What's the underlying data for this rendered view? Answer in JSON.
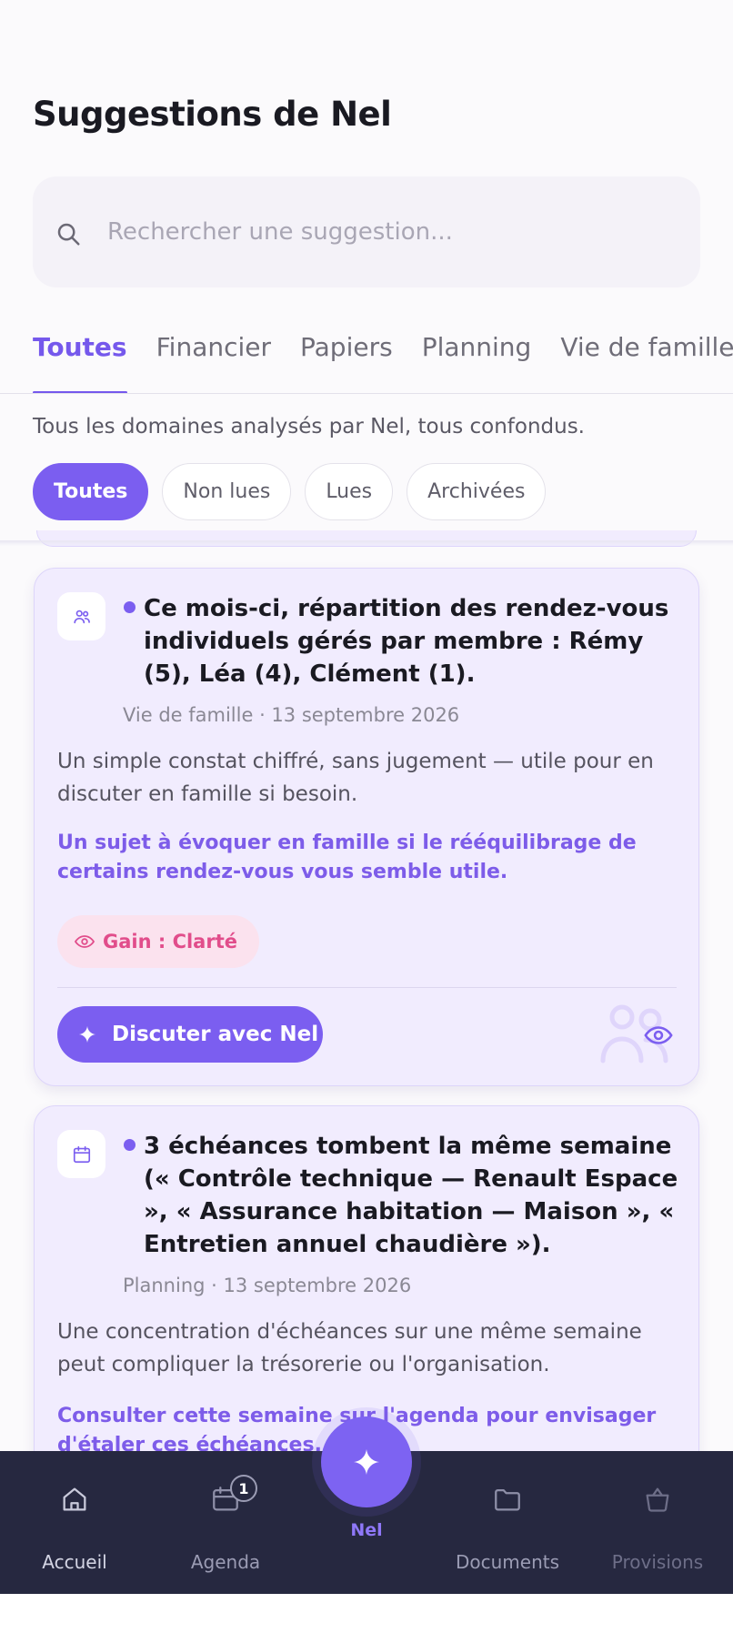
{
  "page": {
    "title": "Suggestions de Nel"
  },
  "search": {
    "placeholder": "Rechercher une suggestion..."
  },
  "tabs": [
    {
      "label": "Toutes",
      "active": true
    },
    {
      "label": "Financier",
      "active": false
    },
    {
      "label": "Papiers",
      "active": false
    },
    {
      "label": "Planning",
      "active": false
    },
    {
      "label": "Vie de famille",
      "active": false
    }
  ],
  "domain_description": "Tous les domaines analysés par Nel, tous confondus.",
  "filters": [
    {
      "label": "Toutes",
      "active": true
    },
    {
      "label": "Non lues",
      "active": false
    },
    {
      "label": "Lues",
      "active": false
    },
    {
      "label": "Archivées",
      "active": false
    }
  ],
  "cards": [
    {
      "icon": "family-icon",
      "title": "Ce mois-ci, répartition des rendez-vous individuels gérés par membre : Rémy (5), Léa (4), Clément (1).",
      "meta": "Vie de famille · 13 septembre 2026",
      "description": "Un simple constat chiffré, sans jugement — utile pour en discuter en famille si besoin.",
      "action": "Un sujet à évoquer en famille si le rééquilibrage de certains rendez-vous vous semble utile.",
      "gain": "Gain : Clarté",
      "cta": "Discuter avec Nel"
    },
    {
      "icon": "calendar-icon",
      "title": "3 échéances tombent la même semaine (« Contrôle technique — Renault Espace », « Assurance habitation — Maison », « Entretien annuel chaudière »).",
      "meta": "Planning · 13 septembre 2026",
      "description": "Une concentration d'échéances sur une même semaine peut compliquer la trésorerie ou l'organisation.",
      "action": "Consulter cette semaine sur l'agenda pour envisager d'étaler ces échéances."
    }
  ],
  "bottom_nav": {
    "home": "Accueil",
    "agenda": "Agenda",
    "agenda_badge": "1",
    "nel": "Nel",
    "documents": "Documents",
    "provisions": "Provisions"
  },
  "colors": {
    "accent": "#7b5ef0",
    "card_bg": "#f1ecfe",
    "gain_bg": "#fbe2ee",
    "gain_text": "#e14d8b",
    "nav_bg": "#262840"
  }
}
